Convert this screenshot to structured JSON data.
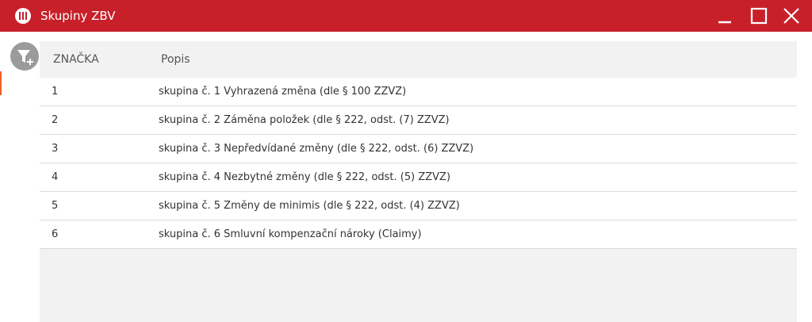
{
  "window": {
    "title": "Skupiny ZBV",
    "controls": {
      "minimize_icon": "minimize-icon",
      "maximize_icon": "maximize-icon",
      "close_icon": "close-icon"
    },
    "accent_color": "#c8202a"
  },
  "toolbar": {
    "filter_icon": "filter-add-icon"
  },
  "table": {
    "columns": [
      "ZNAČKA",
      "Popis"
    ],
    "rows": [
      {
        "znacka": "1",
        "popis": "skupina č. 1 Vyhrazená změna (dle § 100 ZZVZ)"
      },
      {
        "znacka": "2",
        "popis": "skupina č. 2 Záměna položek (dle § 222, odst. (7) ZZVZ)"
      },
      {
        "znacka": "3",
        "popis": "skupina č. 3 Nepředvídané změny (dle § 222, odst. (6) ZZVZ)"
      },
      {
        "znacka": "4",
        "popis": "skupina č. 4 Nezbytné změny (dle § 222, odst. (5) ZZVZ)"
      },
      {
        "znacka": "5",
        "popis": "skupina č. 5 Změny de minimis (dle § 222, odst. (4) ZZVZ)"
      },
      {
        "znacka": "6",
        "popis": "skupina č. 6 Smluvní kompenzační nároky (Claimy)"
      }
    ]
  }
}
